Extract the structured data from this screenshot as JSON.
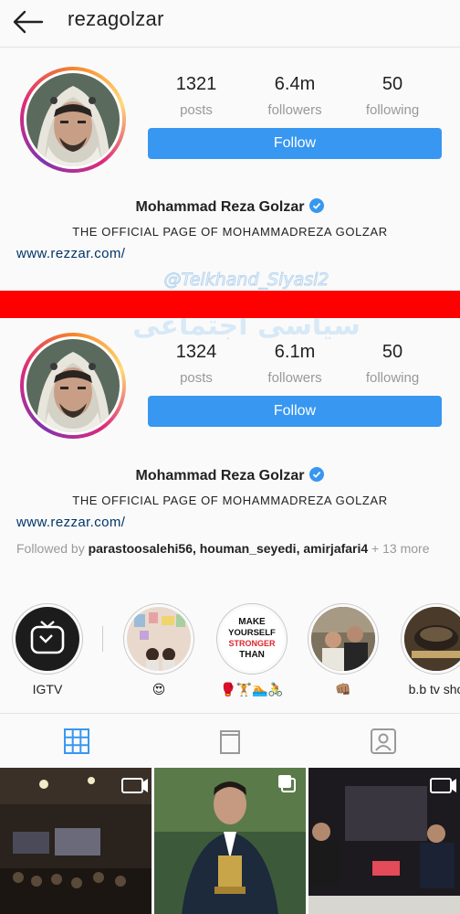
{
  "header": {
    "username": "rezagolzar",
    "back_icon": "arrow-left-icon"
  },
  "profile_old": {
    "posts": "1321",
    "posts_label": "posts",
    "followers": "6.4m",
    "followers_label": "followers",
    "following": "50",
    "following_label": "following",
    "follow_label": "Follow",
    "name": "Mohammad Reza Golzar",
    "bio": "THE OFFICIAL PAGE OF MOHAMMADREZA GOLZAR",
    "link": "www.rezzar.com/"
  },
  "profile_new": {
    "posts": "1324",
    "posts_label": "posts",
    "followers": "6.1m",
    "followers_label": "followers",
    "following": "50",
    "following_label": "following",
    "follow_label": "Follow",
    "name": "Mohammad Reza Golzar",
    "bio": "THE OFFICIAL PAGE OF MOHAMMADREZA GOLZAR",
    "link": "www.rezzar.com/",
    "followed_by_prefix": "Followed by ",
    "followed_by_names": "parastoosalehi56, houman_seyedi, amirjafari4",
    "followed_by_suffix": " + 13 more"
  },
  "highlights": [
    {
      "label": "IGTV"
    },
    {
      "label": "😍"
    },
    {
      "label": "🥊🏋🏊🚴",
      "cover_text": [
        "MAKE",
        "YOURSELF",
        "STRONGER",
        "THAN"
      ]
    },
    {
      "label": "👊🏽"
    },
    {
      "label": "b.b tv sho"
    }
  ],
  "watermark": {
    "line1": "@Telkhand_Siyasi2",
    "line2": "سیاسی اجتماعی"
  },
  "tabs": [
    "grid-icon",
    "igtv-tab-icon",
    "tagged-icon"
  ],
  "colors": {
    "accent": "#3897f0",
    "separator": "#ff0000",
    "link": "#003569"
  }
}
